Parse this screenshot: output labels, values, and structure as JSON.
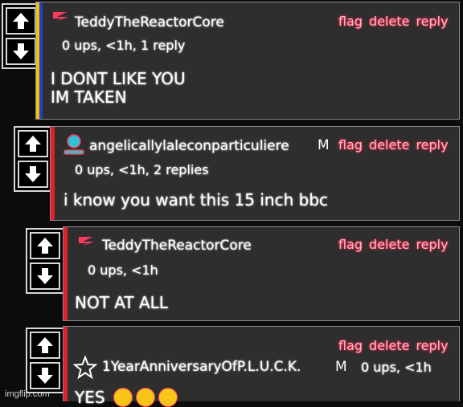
{
  "comments": [
    {
      "username": "TeddyTheReactorCore",
      "meta": "0 ups, <1h, 1 reply",
      "body": "I DONT LIKE YOU\nIM TAKEN",
      "actions": [
        "flag",
        "delete",
        "reply"
      ],
      "stripe_colors": [
        "#f2c200",
        "#1e3fd6"
      ]
    },
    {
      "username": "angelicallylaleconparticuliere",
      "badge": "M",
      "meta": "0 ups, <1h, 2 replies",
      "body": "i know you want this 15 inch bbc",
      "actions": [
        "flag",
        "delete",
        "reply"
      ],
      "stripe_colors": [
        "#e0202a"
      ]
    },
    {
      "username": "TeddyTheReactorCore",
      "meta": "0 ups, <1h",
      "body": "NOT AT ALL",
      "actions": [
        "flag",
        "delete",
        "reply"
      ],
      "stripe_colors": [
        "#e0202a"
      ]
    },
    {
      "username": "1YearAnniversaryOfP.L.U.C.K.",
      "badge": "M",
      "meta": "0 ups, <1h",
      "body": "YES",
      "actions": [
        "flag",
        "delete",
        "reply"
      ],
      "stripe_colors": [
        "#e0202a"
      ]
    }
  ],
  "watermark": "imgflip.com",
  "icons": {
    "upvote": "arrow-up-icon",
    "downvote": "arrow-down-icon",
    "avatar_1": "reactor-logo-icon",
    "avatar_2": "person-icon",
    "avatar_4": "star-icon",
    "emoji": "heart-eyes-emoji"
  }
}
